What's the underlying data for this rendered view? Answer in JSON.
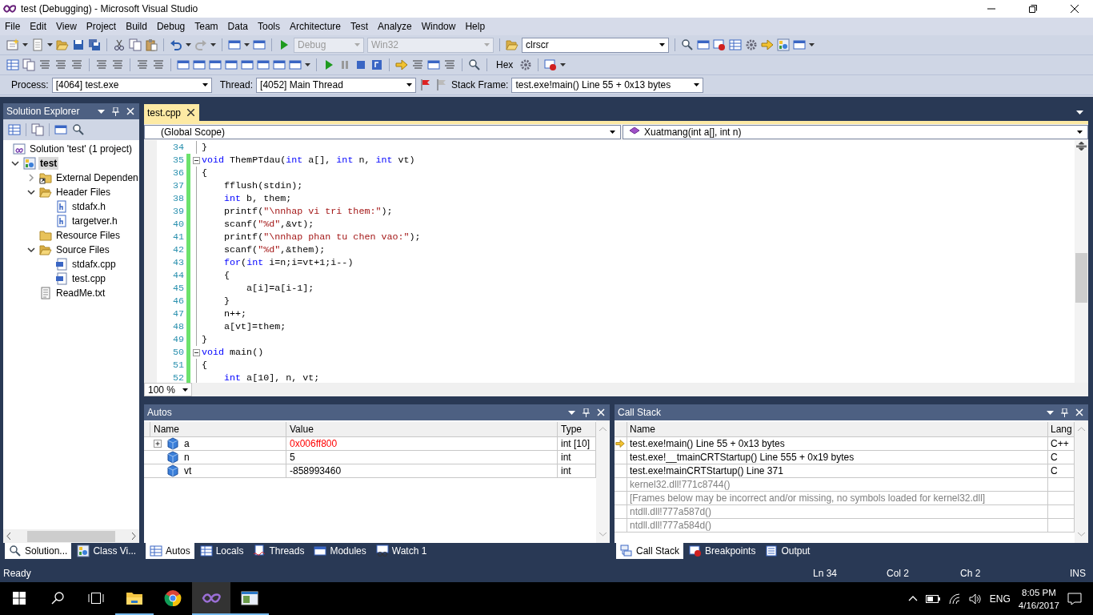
{
  "window": {
    "title": "test (Debugging) - Microsoft Visual Studio"
  },
  "menu": [
    "File",
    "Edit",
    "View",
    "Project",
    "Build",
    "Debug",
    "Team",
    "Data",
    "Tools",
    "Architecture",
    "Test",
    "Analyze",
    "Window",
    "Help"
  ],
  "toolbar": {
    "configuration": {
      "value": "Debug",
      "disabled": true
    },
    "platform": {
      "value": "Win32",
      "disabled": true
    },
    "find": {
      "value": "clrscr"
    },
    "hex": {
      "label": "Hex"
    }
  },
  "debug_location": {
    "process_label": "Process:",
    "process": "[4064] test.exe",
    "thread_label": "Thread:",
    "thread": "[4052] Main Thread",
    "stack_frame_label": "Stack Frame:",
    "stack_frame": "test.exe!main()  Line 55 + 0x13 bytes"
  },
  "solution_explorer": {
    "title": "Solution Explorer",
    "tree": [
      {
        "label": "Solution 'test' (1 project)",
        "kind": "solution",
        "selected": false,
        "children": [
          {
            "label": "test",
            "kind": "project",
            "expanded": true,
            "selected": true,
            "children": [
              {
                "label": "External Dependen",
                "kind": "references",
                "expanded": false,
                "selected": false
              },
              {
                "label": "Header Files",
                "kind": "folder",
                "expanded": true,
                "selected": false,
                "children": [
                  {
                    "label": "stdafx.h",
                    "kind": "header",
                    "selected": false
                  },
                  {
                    "label": "targetver.h",
                    "kind": "header",
                    "selected": false
                  }
                ]
              },
              {
                "label": "Resource Files",
                "kind": "folder",
                "selected": false
              },
              {
                "label": "Source Files",
                "kind": "folder",
                "expanded": true,
                "selected": false,
                "children": [
                  {
                    "label": "stdafx.cpp",
                    "kind": "source",
                    "selected": false
                  },
                  {
                    "label": "test.cpp",
                    "kind": "source",
                    "selected": false
                  }
                ]
              },
              {
                "label": "ReadMe.txt",
                "kind": "text",
                "selected": false
              }
            ]
          }
        ]
      }
    ],
    "tabs": [
      {
        "label": "Solution...",
        "selected": true
      },
      {
        "label": "Class Vi...",
        "selected": false
      }
    ]
  },
  "editor": {
    "tabs": [
      {
        "label": "test.cpp",
        "selected": true
      }
    ],
    "scope": "(Global Scope)",
    "member": "Xuatmang(int a[], int n)",
    "zoom": "100 %",
    "lines": [
      {
        "number": "34",
        "changed": false,
        "fold": false,
        "code": [
          {
            "kind": "text",
            "text": "}"
          }
        ]
      },
      {
        "number": "35",
        "changed": true,
        "fold": true,
        "code": [
          {
            "kind": "keyword",
            "text": "void"
          },
          {
            "kind": "text",
            "text": " ThemPTdau("
          },
          {
            "kind": "keyword",
            "text": "int"
          },
          {
            "kind": "text",
            "text": " a[], "
          },
          {
            "kind": "keyword",
            "text": "int"
          },
          {
            "kind": "text",
            "text": " n, "
          },
          {
            "kind": "keyword",
            "text": "int"
          },
          {
            "kind": "text",
            "text": " vt)"
          }
        ]
      },
      {
        "number": "36",
        "changed": true,
        "fold": false,
        "code": [
          {
            "kind": "text",
            "text": "{"
          }
        ]
      },
      {
        "number": "37",
        "changed": true,
        "fold": false,
        "code": [
          {
            "kind": "text",
            "text": "    fflush(stdin);"
          }
        ]
      },
      {
        "number": "38",
        "changed": true,
        "fold": false,
        "code": [
          {
            "kind": "keyword",
            "text": "    int"
          },
          {
            "kind": "text",
            "text": " b, them;"
          }
        ]
      },
      {
        "number": "39",
        "changed": true,
        "fold": false,
        "code": [
          {
            "kind": "text",
            "text": "    printf("
          },
          {
            "kind": "string",
            "text": "\"\\nnhap vi tri them:\""
          },
          {
            "kind": "text",
            "text": ");"
          }
        ]
      },
      {
        "number": "40",
        "changed": true,
        "fold": false,
        "code": [
          {
            "kind": "text",
            "text": "    scanf("
          },
          {
            "kind": "string",
            "text": "\"%d\""
          },
          {
            "kind": "text",
            "text": ",&vt);"
          }
        ]
      },
      {
        "number": "41",
        "changed": true,
        "fold": false,
        "code": [
          {
            "kind": "text",
            "text": "    printf("
          },
          {
            "kind": "string",
            "text": "\"\\nnhap phan tu chen vao:\""
          },
          {
            "kind": "text",
            "text": ");"
          }
        ]
      },
      {
        "number": "42",
        "changed": true,
        "fold": false,
        "code": [
          {
            "kind": "text",
            "text": "    scanf("
          },
          {
            "kind": "string",
            "text": "\"%d\""
          },
          {
            "kind": "text",
            "text": ",&them);"
          }
        ]
      },
      {
        "number": "43",
        "changed": true,
        "fold": false,
        "code": [
          {
            "kind": "keyword",
            "text": "    for"
          },
          {
            "kind": "text",
            "text": "("
          },
          {
            "kind": "keyword",
            "text": "int"
          },
          {
            "kind": "text",
            "text": " i=n;i=vt+1;i--)"
          }
        ]
      },
      {
        "number": "44",
        "changed": true,
        "fold": false,
        "code": [
          {
            "kind": "text",
            "text": "    {"
          }
        ]
      },
      {
        "number": "45",
        "changed": true,
        "fold": false,
        "code": [
          {
            "kind": "text",
            "text": "        a[i]=a[i-1];"
          }
        ]
      },
      {
        "number": "46",
        "changed": true,
        "fold": false,
        "code": [
          {
            "kind": "text",
            "text": "    }"
          }
        ]
      },
      {
        "number": "47",
        "changed": true,
        "fold": false,
        "code": [
          {
            "kind": "text",
            "text": "    n++;"
          }
        ]
      },
      {
        "number": "48",
        "changed": true,
        "fold": false,
        "code": [
          {
            "kind": "text",
            "text": "    a[vt]=them;"
          }
        ]
      },
      {
        "number": "49",
        "changed": true,
        "fold": false,
        "code": [
          {
            "kind": "text",
            "text": "}"
          }
        ]
      },
      {
        "number": "50",
        "changed": true,
        "fold": true,
        "code": [
          {
            "kind": "keyword",
            "text": "void"
          },
          {
            "kind": "text",
            "text": " main()"
          }
        ]
      },
      {
        "number": "51",
        "changed": true,
        "fold": false,
        "code": [
          {
            "kind": "text",
            "text": "{"
          }
        ]
      },
      {
        "number": "52",
        "changed": true,
        "fold": false,
        "code": [
          {
            "kind": "keyword",
            "text": "    int"
          },
          {
            "kind": "text",
            "text": " a[10], n, vt;"
          }
        ]
      }
    ]
  },
  "autos": {
    "title": "Autos",
    "columns": [
      "Name",
      "Value",
      "Type"
    ],
    "rows": [
      {
        "name": "a",
        "value": "0x006ff800",
        "type": "int [10]",
        "expandable": true,
        "changed": true
      },
      {
        "name": "n",
        "value": "5",
        "type": "int",
        "expandable": false,
        "changed": false
      },
      {
        "name": "vt",
        "value": "-858993460",
        "type": "int",
        "expandable": false,
        "changed": false
      }
    ],
    "tabs": [
      {
        "label": "Autos",
        "selected": true
      },
      {
        "label": "Locals",
        "selected": false
      },
      {
        "label": "Threads",
        "selected": false
      },
      {
        "label": "Modules",
        "selected": false
      },
      {
        "label": "Watch 1",
        "selected": false
      }
    ]
  },
  "call_stack": {
    "title": "Call Stack",
    "columns": [
      "Name",
      "Lang"
    ],
    "rows": [
      {
        "name": "test.exe!main()  Line 55 + 0x13 bytes",
        "lang": "C++",
        "current": true,
        "dimmed": false
      },
      {
        "name": "test.exe!__tmainCRTStartup()  Line 555 + 0x19 bytes",
        "lang": "C",
        "current": false,
        "dimmed": false
      },
      {
        "name": "test.exe!mainCRTStartup()  Line 371",
        "lang": "C",
        "current": false,
        "dimmed": false
      },
      {
        "name": "kernel32.dll!771c8744()",
        "current": false,
        "dimmed": true
      },
      {
        "name": "[Frames below may be incorrect and/or missing, no symbols loaded for kernel32.dll]",
        "current": false,
        "dimmed": true
      },
      {
        "name": "ntdll.dll!777a587d()",
        "current": false,
        "dimmed": true
      },
      {
        "name": "ntdll.dll!777a584d()",
        "current": false,
        "dimmed": true
      }
    ],
    "tabs": [
      {
        "label": "Call Stack",
        "selected": true
      },
      {
        "label": "Breakpoints",
        "selected": false
      },
      {
        "label": "Output",
        "selected": false
      }
    ]
  },
  "status_bar": {
    "message": "Ready",
    "line": "Ln 34",
    "column": "Col 2",
    "char": "Ch 2",
    "mode": "INS"
  },
  "taskbar": {
    "apps": [
      {
        "running": true,
        "selected": false
      },
      {
        "running": false,
        "selected": false
      },
      {
        "running": true,
        "selected": true
      },
      {
        "running": true,
        "selected": false
      }
    ],
    "language": "ENG",
    "time": "8:05 PM",
    "date": "4/16/2017"
  }
}
